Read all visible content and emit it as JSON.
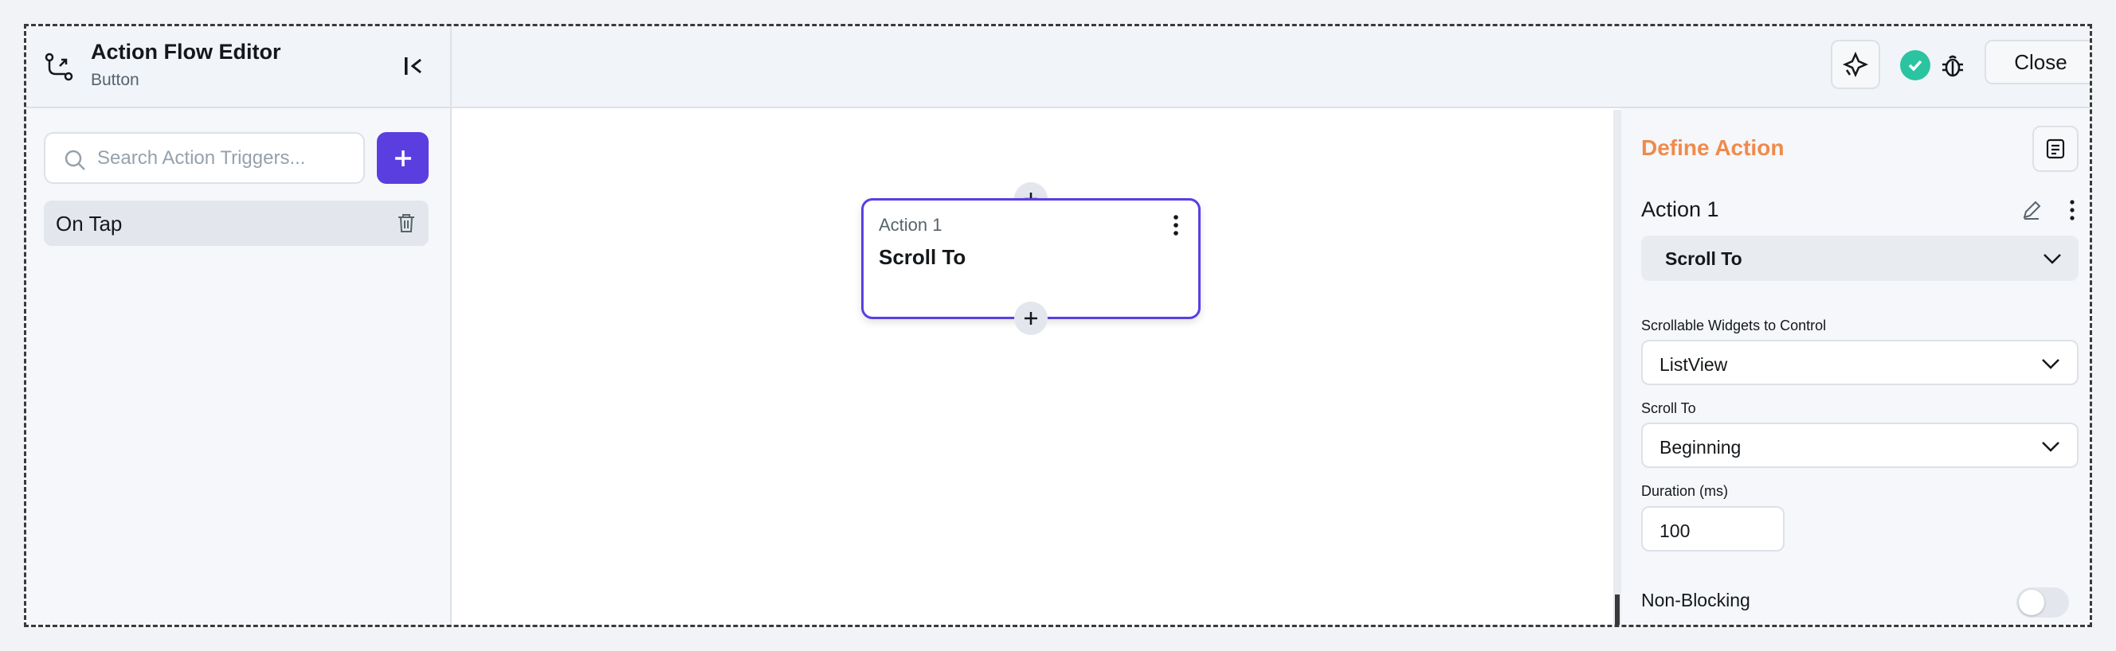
{
  "header": {
    "title": "Action Flow Editor",
    "subtitle": "Button",
    "close_label": "Close",
    "icons": [
      "flow-branch-icon",
      "collapse-sidebar-icon",
      "ai-sparkle-icon",
      "success-check-icon",
      "bug-icon"
    ]
  },
  "sidebar": {
    "search_placeholder": "Search Action Triggers...",
    "triggers": [
      {
        "label": "On Tap"
      }
    ]
  },
  "canvas": {
    "node": {
      "subtitle": "Action 1",
      "title": "Scroll To"
    }
  },
  "panel": {
    "title": "Define Action",
    "action_name": "Action 1",
    "action_type": "Scroll To",
    "fields": [
      {
        "label": "Scrollable Widgets to Control",
        "value": "ListView"
      },
      {
        "label": "Scroll To",
        "value": "Beginning"
      },
      {
        "label": "Duration (ms)",
        "value": "100"
      }
    ],
    "non_blocking_label": "Non-Blocking",
    "non_blocking_enabled": false
  },
  "colors": {
    "accent": "#5b3ee0",
    "panel_title": "#f08a4b",
    "success": "#2bc4a0"
  }
}
